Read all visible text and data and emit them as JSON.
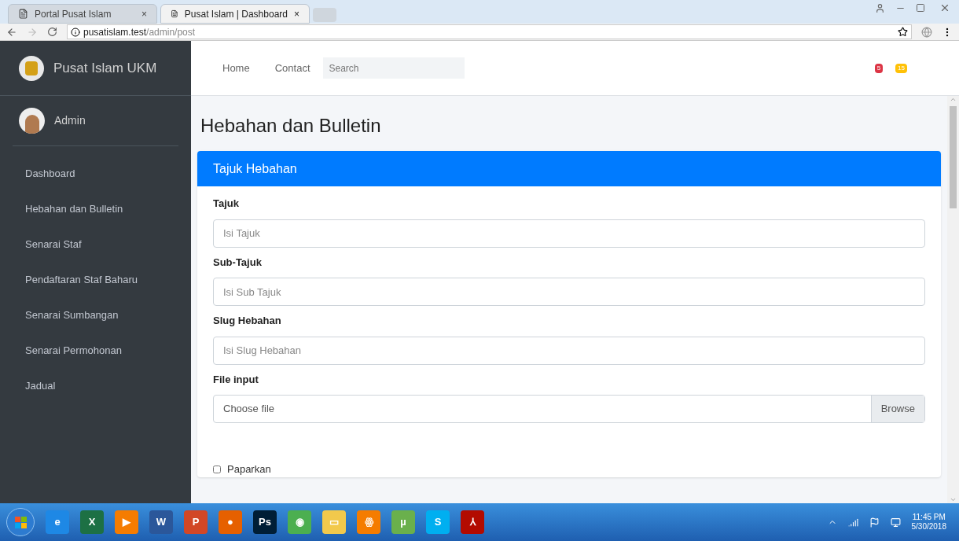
{
  "browser": {
    "tabs": [
      {
        "title": "Portal Pusat Islam",
        "close": "×",
        "selected": false
      },
      {
        "title": "Pusat Islam | Dashboard",
        "close": "×",
        "selected": true
      }
    ],
    "url_host": "pusatislam.test",
    "url_path": "/admin/post"
  },
  "sidebar": {
    "brand": "Pusat Islam UKM",
    "user": "Admin",
    "items": [
      {
        "label": "Dashboard",
        "selected": false
      },
      {
        "label": "Hebahan dan Bulletin",
        "selected": false
      },
      {
        "label": "Senarai Staf",
        "selected": false
      },
      {
        "label": "Pendaftaran Staf Baharu",
        "selected": false
      },
      {
        "label": "Senarai Sumbangan",
        "selected": false
      },
      {
        "label": "Senarai Permohonan",
        "selected": false
      },
      {
        "label": "Jadual",
        "selected": false
      }
    ]
  },
  "topbar": {
    "links": [
      "Home",
      "Contact"
    ],
    "search": {
      "placeholder": "Search"
    },
    "badges": [
      {
        "text": "5",
        "color": "#dc3545"
      },
      {
        "text": "15",
        "color": "#ffc107"
      }
    ]
  },
  "page_title": "Hebahan dan Bulletin",
  "card": {
    "header": "Tajuk Hebahan",
    "fields": [
      {
        "kind": "text",
        "label": "Tajuk",
        "placeholder": "Isi Tajuk"
      },
      {
        "kind": "text",
        "label": "Sub-Tajuk",
        "placeholder": "Isi Sub Tajuk"
      },
      {
        "kind": "text",
        "label": "Slug Hebahan",
        "placeholder": "Isi Slug Hebahan"
      },
      {
        "kind": "file",
        "label": "File input",
        "placeholder": "Choose file",
        "button": "Browse"
      }
    ],
    "checkbox": {
      "label": "Paparkan",
      "checked": false
    }
  },
  "taskbar": {
    "apps": [
      {
        "label": "e",
        "color": "#1e88e5"
      },
      {
        "label": "X",
        "color": "#1d7044"
      },
      {
        "label": "▶",
        "color": "#f57c00"
      },
      {
        "label": "W",
        "color": "#2b579a"
      },
      {
        "label": "P",
        "color": "#d24726"
      },
      {
        "label": "●",
        "color": "#e66000"
      },
      {
        "label": "Ps",
        "color": "#001e36"
      },
      {
        "label": "◉",
        "color": "#4caf50"
      },
      {
        "label": "▭",
        "color": "#f2c94c"
      },
      {
        "label": "ꙮ",
        "color": "#f57c00"
      },
      {
        "label": "µ",
        "color": "#6ab04c"
      },
      {
        "label": "S",
        "color": "#00aff0"
      },
      {
        "label": "⅄",
        "color": "#b30b00"
      }
    ],
    "time": "11:45 PM",
    "date": "5/30/2018"
  }
}
